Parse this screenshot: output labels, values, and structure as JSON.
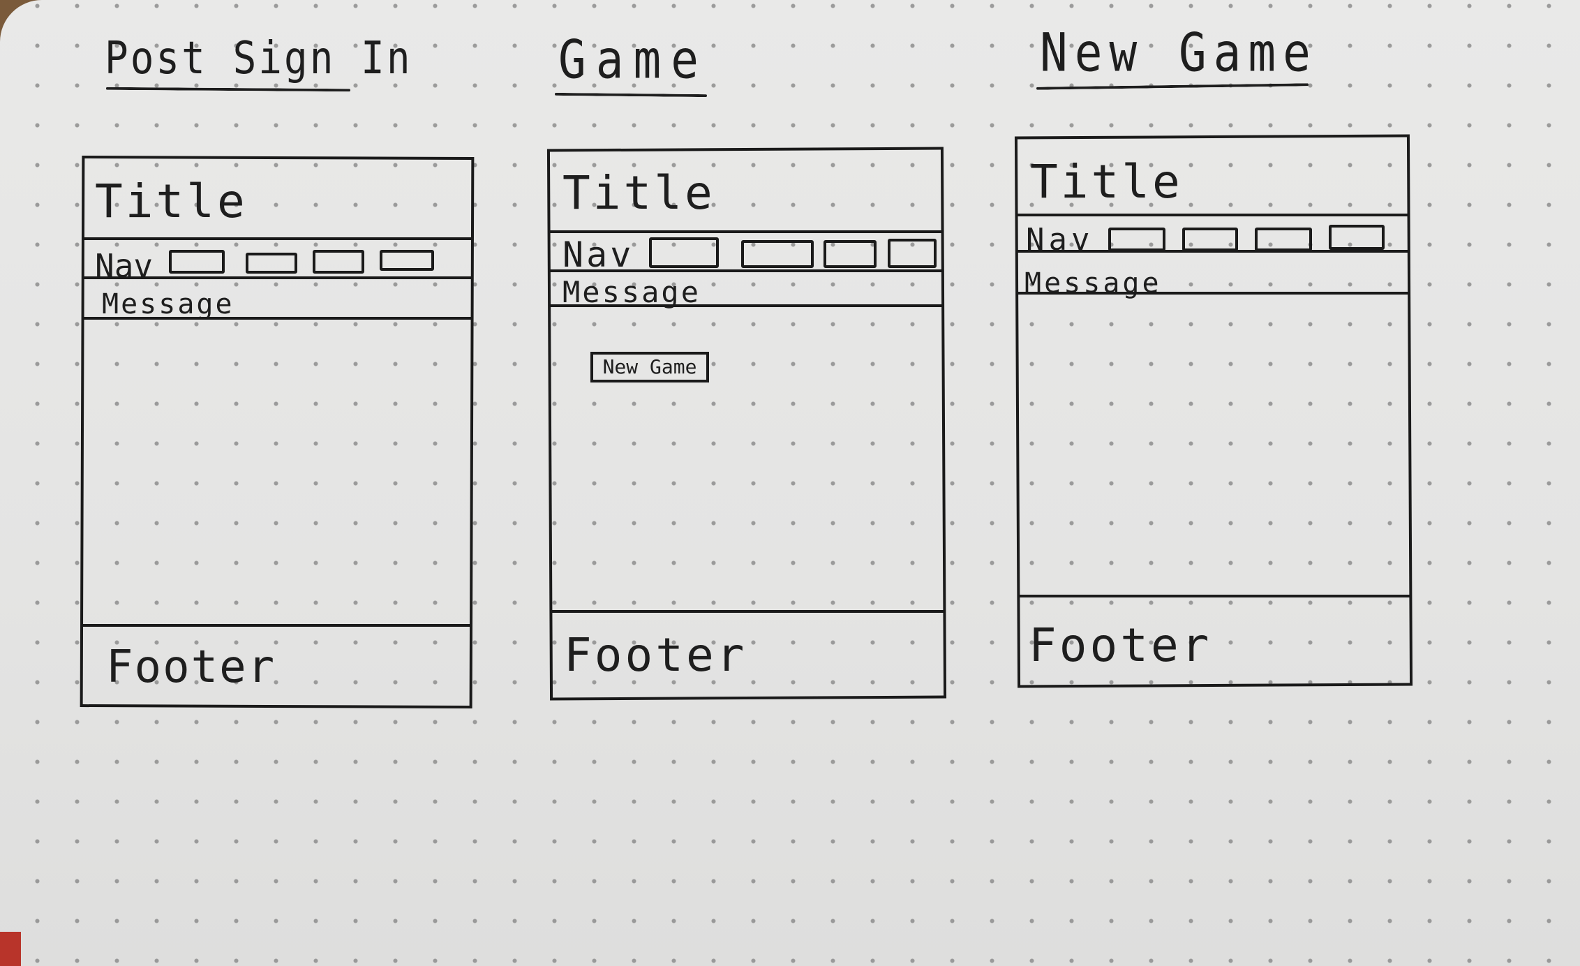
{
  "headings": {
    "post_sign_in": "Post Sign In",
    "game": "Game",
    "new_game": "New Game"
  },
  "wireframes": [
    {
      "title": "Title",
      "nav": "Nav",
      "message": "Message",
      "footer": "Footer"
    },
    {
      "title": "Title",
      "nav": "Nav",
      "message": "Message",
      "footer": "Footer",
      "button_label": "New Game"
    },
    {
      "title": "Title",
      "nav": "Nav",
      "message": "Message",
      "footer": "Footer"
    }
  ],
  "colors": {
    "ink": "#1a1a1a",
    "paper": "#e6e6e5",
    "dot": "#8d8d8d",
    "wood": "#a07d55",
    "red_accent": "#b8342a"
  }
}
